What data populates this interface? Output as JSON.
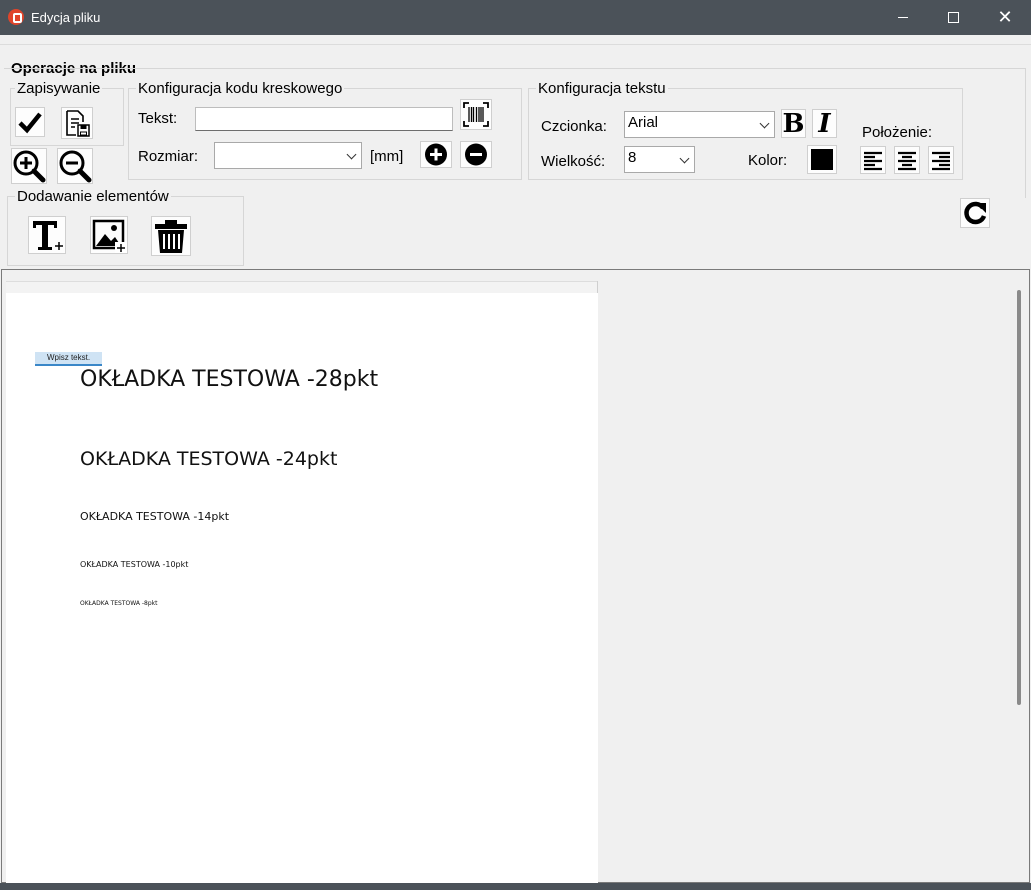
{
  "window": {
    "title": "Edycja pliku",
    "min": "–",
    "max": "□",
    "close": "✕"
  },
  "operations": {
    "title": "Operacje na pliku",
    "saving": {
      "legend": "Zapisywanie"
    },
    "barcode": {
      "legend": "Konfiguracja kodu kreskowego",
      "text_label": "Tekst:",
      "text_value": "",
      "size_label": "Rozmiar:",
      "size_value": "",
      "unit": "[mm]"
    },
    "text_config": {
      "legend": "Konfiguracja tekstu",
      "font_label": "Czcionka:",
      "font_value": "Arial",
      "size_label": "Wielkość:",
      "size_value": "8",
      "color_label": "Kolor:",
      "color_value": "#000000",
      "position_label": "Położenie:",
      "bold": "B",
      "italic": "I"
    },
    "add_elements": {
      "legend": "Dodawanie elementów"
    }
  },
  "document": {
    "input_placeholder": "Wpisz tekst.",
    "lines": [
      {
        "text": "OKŁADKA TESTOWA -28pkt"
      },
      {
        "text": "OKŁADKA TESTOWA -24pkt"
      },
      {
        "text": "OKŁADKA TESTOWA -14pkt"
      },
      {
        "text": "OKŁADKA TESTOWA -10pkt"
      },
      {
        "text": "OKŁADKA TESTOWA -8pkt"
      }
    ]
  }
}
